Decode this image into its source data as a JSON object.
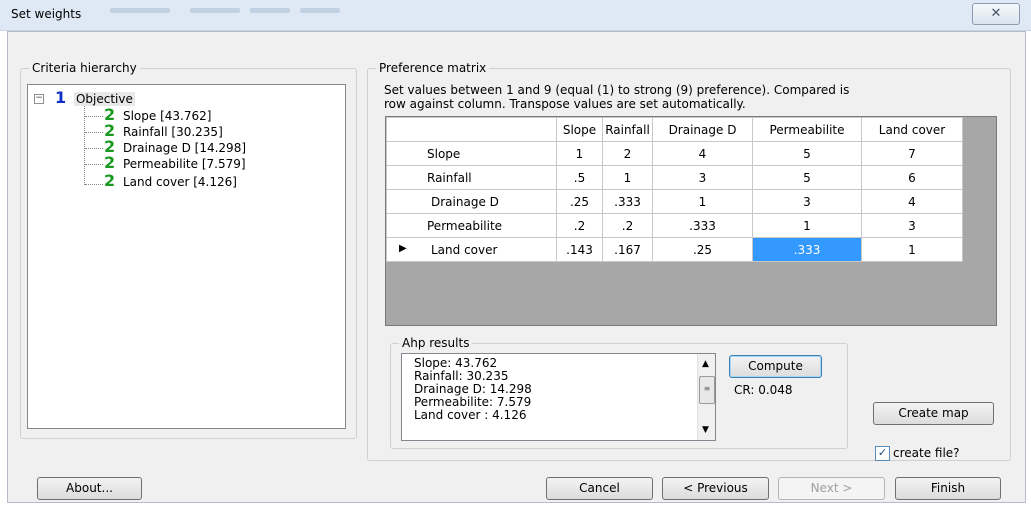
{
  "window": {
    "title": "Set weights",
    "close_glyph": "✕"
  },
  "criteria_panel": {
    "legend": "Criteria hierarchy",
    "root": {
      "level": "1",
      "label": "Objective",
      "expander": "−"
    },
    "children": [
      {
        "level": "2",
        "label": "Slope [43.762]"
      },
      {
        "level": "2",
        "label": "Rainfall [30.235]"
      },
      {
        "level": "2",
        "label": "Drainage D [14.298]"
      },
      {
        "level": "2",
        "label": "Permeabilite [7.579]"
      },
      {
        "level": "2",
        "label": "Land cover  [4.126]"
      }
    ]
  },
  "preference_panel": {
    "legend": "Preference matrix",
    "instruction_line1": "Set values between 1 and 9 (equal (1) to strong (9) preference). Compared is",
    "instruction_line2": "row against column. Transpose values are set automatically.",
    "columns": [
      "Slope",
      "Rainfall",
      "Drainage D",
      "Permeabilite",
      "Land cover"
    ],
    "rows": [
      {
        "label": "Slope",
        "values": [
          "1",
          "2",
          "4",
          "5",
          "7"
        ]
      },
      {
        "label": "Rainfall",
        "values": [
          ".5",
          "1",
          "3",
          "5",
          "6"
        ]
      },
      {
        "label": "Drainage D",
        "values": [
          ".25",
          ".333",
          "1",
          "3",
          "4"
        ]
      },
      {
        "label": "Permeabilite",
        "values": [
          ".2",
          ".2",
          ".333",
          "1",
          "3"
        ]
      },
      {
        "label": "Land cover",
        "values": [
          ".143",
          ".167",
          ".25",
          ".333",
          "1"
        ]
      }
    ],
    "current_row_marker": "▶",
    "selected_cell_color": "#3399ff"
  },
  "ahp_panel": {
    "legend": "Ahp results",
    "results": [
      "Slope: 43.762",
      "Rainfall: 30.235",
      " Drainage D: 14.298",
      "Permeabilite: 7.579",
      " Land cover : 4.126"
    ],
    "compute_label": "Compute",
    "cr_text": "CR: 0.048"
  },
  "create_map_label": "Create map",
  "create_file": {
    "label": "create file?",
    "checked": true,
    "check_glyph": "✓"
  },
  "footer": {
    "about_label": "About...",
    "cancel_label": "Cancel",
    "previous_label": "< Previous",
    "next_label": "Next >",
    "finish_label": "Finish"
  }
}
